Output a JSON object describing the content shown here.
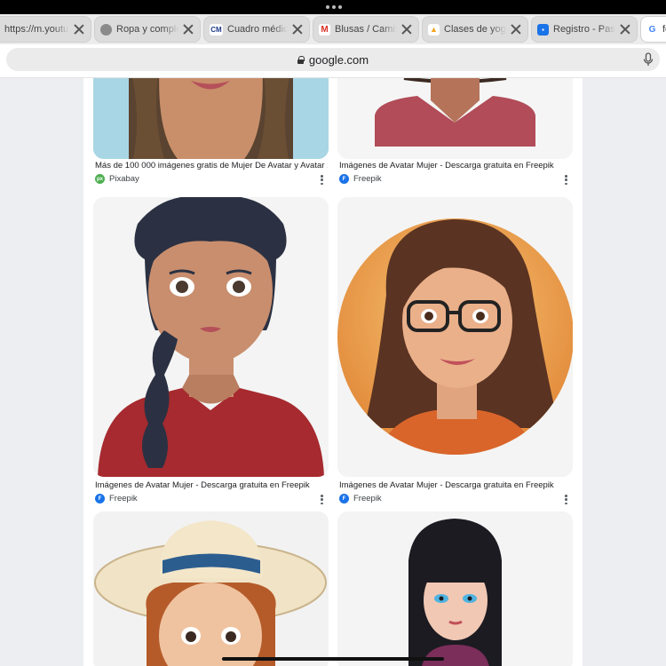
{
  "browser": {
    "tabs": [
      {
        "title": "https://m.youtu",
        "favicon": "youtube-icon",
        "color": "#e53935"
      },
      {
        "title": "Ropa y completo",
        "favicon": "globe-icon",
        "color": "#6b6b6b"
      },
      {
        "title": "Cuadro médico",
        "favicon": "cm-icon",
        "color": "#1e3a8a"
      },
      {
        "title": "Blusas / Camisas",
        "favicon": "gmail-icon",
        "color": "#d93025"
      },
      {
        "title": "Clases de yoga",
        "favicon": "yoga-icon",
        "color": "#f5a623"
      },
      {
        "title": "Registro - Pase",
        "favicon": "registro-icon",
        "color": "#1a73e8"
      },
      {
        "title": "fo",
        "favicon": "google-icon",
        "color": "#4285f4"
      }
    ],
    "address": "google.com"
  },
  "results": [
    {
      "caption": "Más de 100 000 imágenes gratis de Mujer De Avatar y Avatar ...",
      "source": "Pixabay",
      "source_color": "#4caf50",
      "source_icon": "pixabay-icon"
    },
    {
      "caption": "Imágenes de Avatar Mujer - Descarga gratuita en Freepik",
      "source": "Freepik",
      "source_color": "#1a73e8",
      "source_icon": "freepik-icon"
    },
    {
      "caption": "Imágenes de Avatar Mujer - Descarga gratuita en Freepik",
      "source": "Freepik",
      "source_color": "#1a73e8",
      "source_icon": "freepik-icon"
    },
    {
      "caption": "Imágenes de Avatar Mujer - Descarga gratuita en Freepik",
      "source": "Freepik",
      "source_color": "#1a73e8",
      "source_icon": "freepik-icon"
    },
    {
      "caption": "",
      "source": "",
      "source_color": "",
      "source_icon": ""
    },
    {
      "caption": "",
      "source": "",
      "source_color": "",
      "source_icon": ""
    }
  ]
}
